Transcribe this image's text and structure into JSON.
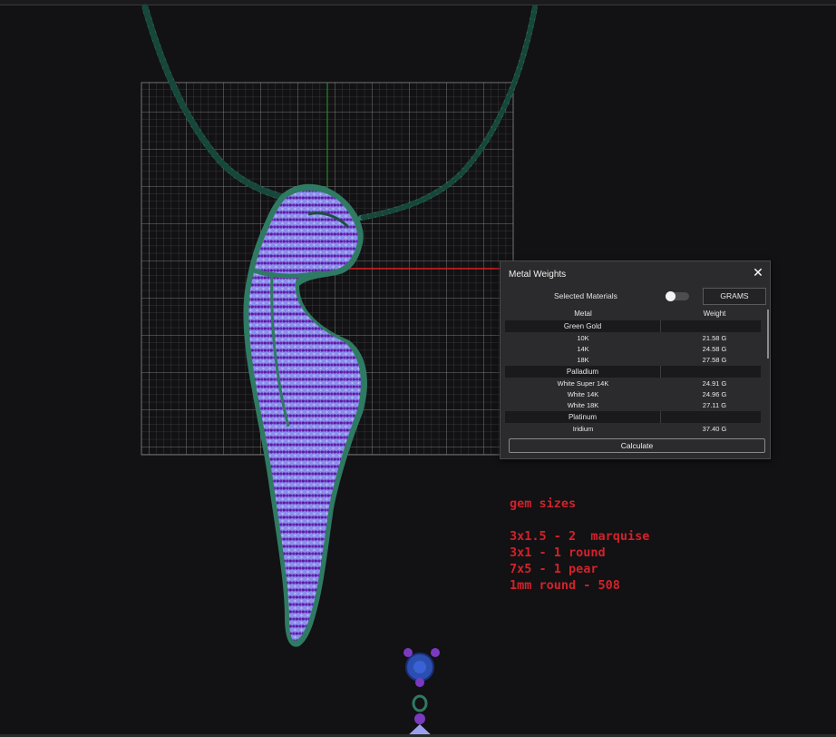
{
  "colors": {
    "background": "#121113",
    "chain": "#2e7a62",
    "gem_body": "#7f83e8",
    "gem_dots": "#6a1fb0",
    "axis_red": "#d81c1c",
    "axis_green": "#1f8a26",
    "annotation": "#d2222b",
    "panel_bg": "#2b2b2d"
  },
  "metal_panel": {
    "title": "Metal Weights",
    "close_icon": "✕",
    "selected_materials_label": "Selected Materials",
    "toggle_state": "off",
    "units_button": "GRAMS",
    "columns": [
      "Metal",
      "Weight"
    ],
    "groups": [
      {
        "name": "Green Gold",
        "rows": [
          {
            "metal": "10K",
            "weight": "21.58 G"
          },
          {
            "metal": "14K",
            "weight": "24.58 G"
          },
          {
            "metal": "18K",
            "weight": "27.58 G"
          }
        ]
      },
      {
        "name": "Palladium",
        "rows": [
          {
            "metal": "White Super 14K",
            "weight": "24.91 G"
          },
          {
            "metal": "White 14K",
            "weight": "24.96 G"
          },
          {
            "metal": "White 18K",
            "weight": "27.11 G"
          }
        ]
      },
      {
        "name": "Platinum",
        "rows": [
          {
            "metal": "Iridium",
            "weight": "37.40 G"
          }
        ]
      }
    ],
    "calculate_button": "Calculate"
  },
  "annotation": {
    "title": "gem sizes",
    "lines": [
      "3x1.5 - 2  marquise",
      "3x1 - 1 round",
      "7x5 - 1 pear",
      "1mm round - 508"
    ]
  }
}
